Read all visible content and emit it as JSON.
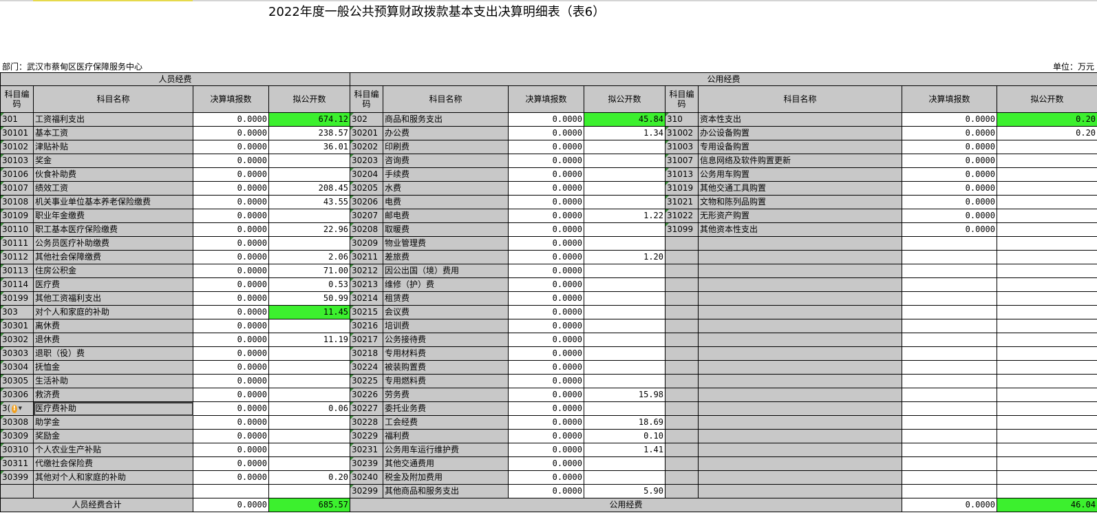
{
  "title": "2022年度一般公共预算财政拨款基本支出决算明细表（表6）",
  "department": "部门：武汉市蔡甸区医疗保障服务中心",
  "unit": "单位：万元",
  "headers": {
    "personnel": "人员经费",
    "public": "公用经费",
    "code": "科目编码",
    "name": "科目名称",
    "reported": "决算填报数",
    "disclosed": "拟公开数"
  },
  "colors": {
    "highlight": "#3cf02e",
    "header_bg": "#c8c8c8"
  },
  "personnel_rows": [
    {
      "code": "301",
      "name": "工资福利支出",
      "reported": "0.0000",
      "disclosed": "674.12",
      "level": 1,
      "hl": true
    },
    {
      "code": "30101",
      "name": "基本工资",
      "reported": "0.0000",
      "disclosed": "238.57",
      "level": 2
    },
    {
      "code": "30102",
      "name": "津贴补贴",
      "reported": "0.0000",
      "disclosed": "36.01",
      "level": 2
    },
    {
      "code": "30103",
      "name": "奖金",
      "reported": "0.0000",
      "disclosed": "",
      "level": 2
    },
    {
      "code": "30106",
      "name": "伙食补助费",
      "reported": "0.0000",
      "disclosed": "",
      "level": 2
    },
    {
      "code": "30107",
      "name": "绩效工资",
      "reported": "0.0000",
      "disclosed": "208.45",
      "level": 2
    },
    {
      "code": "30108",
      "name": "机关事业单位基本养老保险缴费",
      "reported": "0.0000",
      "disclosed": "43.55",
      "level": 2
    },
    {
      "code": "30109",
      "name": "职业年金缴费",
      "reported": "0.0000",
      "disclosed": "",
      "level": 2
    },
    {
      "code": "30110",
      "name": "职工基本医疗保险缴费",
      "reported": "0.0000",
      "disclosed": "22.96",
      "level": 2
    },
    {
      "code": "30111",
      "name": "公务员医疗补助缴费",
      "reported": "0.0000",
      "disclosed": "",
      "level": 2
    },
    {
      "code": "30112",
      "name": "其他社会保障缴费",
      "reported": "0.0000",
      "disclosed": "2.06",
      "level": 2
    },
    {
      "code": "30113",
      "name": "住房公积金",
      "reported": "0.0000",
      "disclosed": "71.00",
      "level": 2
    },
    {
      "code": "30114",
      "name": "医疗费",
      "reported": "0.0000",
      "disclosed": "0.53",
      "level": 2
    },
    {
      "code": "30199",
      "name": "其他工资福利支出",
      "reported": "0.0000",
      "disclosed": "50.99",
      "level": 2
    },
    {
      "code": "303",
      "name": "对个人和家庭的补助",
      "reported": "0.0000",
      "disclosed": "11.45",
      "level": 1,
      "hl": true
    },
    {
      "code": "30301",
      "name": "离休费",
      "reported": "0.0000",
      "disclosed": "",
      "level": 2
    },
    {
      "code": "30302",
      "name": "退休费",
      "reported": "0.0000",
      "disclosed": "11.19",
      "level": 2
    },
    {
      "code": "30303",
      "name": "退职（役）费",
      "reported": "0.0000",
      "disclosed": "",
      "level": 2
    },
    {
      "code": "30304",
      "name": "抚恤金",
      "reported": "0.0000",
      "disclosed": "",
      "level": 2
    },
    {
      "code": "30305",
      "name": "生活补助",
      "reported": "0.0000",
      "disclosed": "",
      "level": 2
    },
    {
      "code": "30306",
      "name": "救济费",
      "reported": "0.0000",
      "disclosed": "",
      "level": 2
    },
    {
      "code": "3(",
      "name": "医疗费补助",
      "reported": "0.0000",
      "disclosed": "0.06",
      "level": 2,
      "warn": true
    },
    {
      "code": "30308",
      "name": "助学金",
      "reported": "0.0000",
      "disclosed": "",
      "level": 2
    },
    {
      "code": "30309",
      "name": "奖励金",
      "reported": "0.0000",
      "disclosed": "",
      "level": 2
    },
    {
      "code": "30310",
      "name": "个人农业生产补贴",
      "reported": "0.0000",
      "disclosed": "",
      "level": 2
    },
    {
      "code": "30311",
      "name": "代缴社会保险费",
      "reported": "0.0000",
      "disclosed": "",
      "level": 2
    },
    {
      "code": "30399",
      "name": "其他对个人和家庭的补助",
      "reported": "0.0000",
      "disclosed": "0.20",
      "level": 2
    },
    {
      "code": "",
      "name": "",
      "reported": "",
      "disclosed": "",
      "level": 0
    }
  ],
  "goods_rows": [
    {
      "code": "302",
      "name": "商品和服务支出",
      "reported": "0.0000",
      "disclosed": "45.84",
      "level": 1,
      "hl": true
    },
    {
      "code": "30201",
      "name": "办公费",
      "reported": "0.0000",
      "disclosed": "1.34",
      "level": 2
    },
    {
      "code": "30202",
      "name": "印刷费",
      "reported": "0.0000",
      "disclosed": "",
      "level": 2
    },
    {
      "code": "30203",
      "name": "咨询费",
      "reported": "0.0000",
      "disclosed": "",
      "level": 2
    },
    {
      "code": "30204",
      "name": "手续费",
      "reported": "0.0000",
      "disclosed": "",
      "level": 2
    },
    {
      "code": "30205",
      "name": "水费",
      "reported": "0.0000",
      "disclosed": "",
      "level": 2
    },
    {
      "code": "30206",
      "name": "电费",
      "reported": "0.0000",
      "disclosed": "",
      "level": 2
    },
    {
      "code": "30207",
      "name": "邮电费",
      "reported": "0.0000",
      "disclosed": "1.22",
      "level": 2
    },
    {
      "code": "30208",
      "name": "取暖费",
      "reported": "0.0000",
      "disclosed": "",
      "level": 2
    },
    {
      "code": "30209",
      "name": "物业管理费",
      "reported": "0.0000",
      "disclosed": "",
      "level": 2
    },
    {
      "code": "30211",
      "name": "差旅费",
      "reported": "0.0000",
      "disclosed": "1.20",
      "level": 2
    },
    {
      "code": "30212",
      "name": "因公出国（境）费用",
      "reported": "0.0000",
      "disclosed": "",
      "level": 2
    },
    {
      "code": "30213",
      "name": "维修（护）费",
      "reported": "0.0000",
      "disclosed": "",
      "level": 2
    },
    {
      "code": "30214",
      "name": "租赁费",
      "reported": "0.0000",
      "disclosed": "",
      "level": 2
    },
    {
      "code": "30215",
      "name": "会议费",
      "reported": "0.0000",
      "disclosed": "",
      "level": 2
    },
    {
      "code": "30216",
      "name": "培训费",
      "reported": "0.0000",
      "disclosed": "",
      "level": 2
    },
    {
      "code": "30217",
      "name": "公务接待费",
      "reported": "0.0000",
      "disclosed": "",
      "level": 2
    },
    {
      "code": "30218",
      "name": "专用材料费",
      "reported": "0.0000",
      "disclosed": "",
      "level": 2
    },
    {
      "code": "30224",
      "name": "被装购置费",
      "reported": "0.0000",
      "disclosed": "",
      "level": 2
    },
    {
      "code": "30225",
      "name": "专用燃料费",
      "reported": "0.0000",
      "disclosed": "",
      "level": 2
    },
    {
      "code": "30226",
      "name": "劳务费",
      "reported": "0.0000",
      "disclosed": "15.98",
      "level": 2
    },
    {
      "code": "30227",
      "name": "委托业务费",
      "reported": "0.0000",
      "disclosed": "",
      "level": 2
    },
    {
      "code": "30228",
      "name": "工会经费",
      "reported": "0.0000",
      "disclosed": "18.69",
      "level": 2
    },
    {
      "code": "30229",
      "name": "福利费",
      "reported": "0.0000",
      "disclosed": "0.10",
      "level": 2
    },
    {
      "code": "30231",
      "name": "公务用车运行维护费",
      "reported": "0.0000",
      "disclosed": "1.41",
      "level": 2
    },
    {
      "code": "30239",
      "name": "其他交通费用",
      "reported": "0.0000",
      "disclosed": "",
      "level": 2
    },
    {
      "code": "30240",
      "name": "税金及附加费用",
      "reported": "0.0000",
      "disclosed": "",
      "level": 2
    },
    {
      "code": "30299",
      "name": "其他商品和服务支出",
      "reported": "0.0000",
      "disclosed": "5.90",
      "level": 2
    }
  ],
  "capital_rows": [
    {
      "code": "310",
      "name": "资本性支出",
      "reported": "0.0000",
      "disclosed": "0.20",
      "level": 1,
      "hl": true
    },
    {
      "code": "31002",
      "name": "办公设备购置",
      "reported": "0.0000",
      "disclosed": "0.20",
      "level": 2
    },
    {
      "code": "31003",
      "name": "专用设备购置",
      "reported": "0.0000",
      "disclosed": "",
      "level": 2
    },
    {
      "code": "31007",
      "name": "信息网络及软件购置更新",
      "reported": "0.0000",
      "disclosed": "",
      "level": 2
    },
    {
      "code": "31013",
      "name": "公务用车购置",
      "reported": "0.0000",
      "disclosed": "",
      "level": 2
    },
    {
      "code": "31019",
      "name": "其他交通工具购置",
      "reported": "0.0000",
      "disclosed": "",
      "level": 2
    },
    {
      "code": "31021",
      "name": "文物和陈列品购置",
      "reported": "0.0000",
      "disclosed": "",
      "level": 2
    },
    {
      "code": "31022",
      "name": "无形资产购置",
      "reported": "0.0000",
      "disclosed": "",
      "level": 2
    },
    {
      "code": "31099",
      "name": "其他资本性支出",
      "reported": "0.0000",
      "disclosed": "",
      "level": 2
    }
  ],
  "totals": {
    "personnel_label": "人员经费合计",
    "personnel_reported": "0.0000",
    "personnel_disclosed": "685.57",
    "public_label": "公用经费",
    "public_reported": "0.0000",
    "public_disclosed": "46.04"
  }
}
